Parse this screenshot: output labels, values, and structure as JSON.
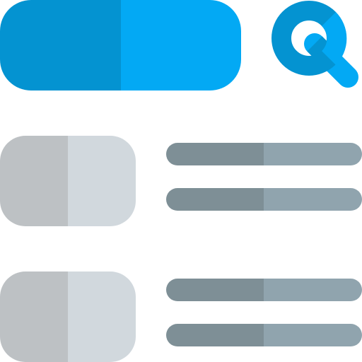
{
  "icon": {
    "name": "search-results-list-icon",
    "colors": {
      "search_dark": "#0493d1",
      "search_light": "#03a9f4",
      "thumb_dark": "#bdc1c4",
      "thumb_light": "#d1d8dd",
      "line_dark": "#7e8f96",
      "line_light": "#90a4ae"
    },
    "results": [
      {
        "lines": 2
      },
      {
        "lines": 2
      }
    ]
  }
}
